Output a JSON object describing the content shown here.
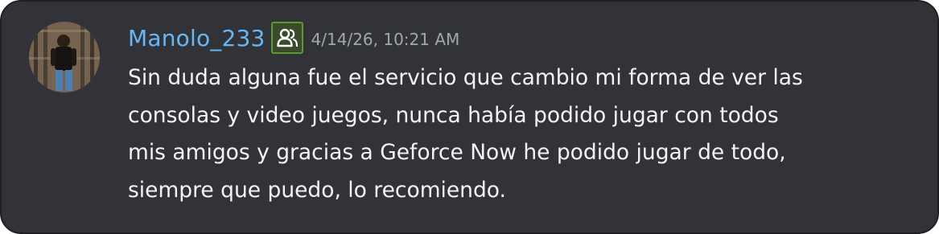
{
  "message": {
    "username": "Manolo_233",
    "timestamp": "4/14/26, 10:21 AM",
    "badge_icon": "users-icon",
    "avatar": "user-avatar-photo",
    "lines": [
      "Sin duda alguna fue el servicio que cambio mi forma de ver las",
      "consolas y video juegos, nunca había podido jugar con todos",
      "mis amigos y gracias a Geforce Now he podido jugar de todo,",
      "siempre que puedo, lo recomiendo."
    ]
  },
  "colors": {
    "background": "#313338",
    "username": "#68b7f3",
    "badge_border": "#5c9a2b",
    "timestamp": "#a3a6aa",
    "text": "#f2f3f5"
  }
}
